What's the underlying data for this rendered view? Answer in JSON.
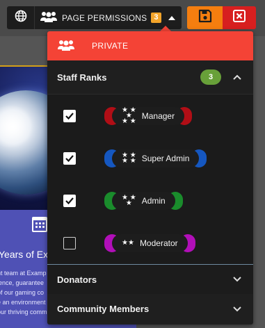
{
  "toolbar": {
    "globe_icon": "globe-icon",
    "permissions_icon": "users-icon",
    "permissions_label": "PAGE PERMISSIONS",
    "permissions_count": "3",
    "caret_icon": "caret-up-icon",
    "save_icon": "floppy-disk-icon",
    "close_icon": "close-square-icon",
    "colors": {
      "bar": "#1d1d1d",
      "badge": "#f3a42a",
      "save": "#f57e0f",
      "close": "#d71f1f"
    }
  },
  "dropdown": {
    "private": {
      "label": "PRIVATE",
      "icon": "users-icon",
      "color": "#f44336"
    },
    "sections": [
      {
        "title": "Staff Ranks",
        "count": "3",
        "count_color": "#68a039",
        "expanded": true,
        "chevron": "chevron-up-icon",
        "ranks": [
          {
            "name": "Manager",
            "checked": true,
            "color": "#b10e16",
            "stars": "5-stars"
          },
          {
            "name": "Super Admin",
            "checked": true,
            "color": "#1557c0",
            "stars": "4-stars"
          },
          {
            "name": "Admin",
            "checked": true,
            "color": "#1a8c2c",
            "stars": "3-stars"
          },
          {
            "name": "Moderator",
            "checked": false,
            "color": "#b10fb8",
            "stars": "2-stars"
          }
        ]
      },
      {
        "title": "Donators",
        "expanded": false,
        "chevron": "chevron-down-icon"
      },
      {
        "title": "Community Members",
        "expanded": false,
        "chevron": "chevron-down-icon"
      }
    ]
  },
  "background": {
    "headline": "Years of Exp",
    "lines": [
      "nt team at Examp",
      "ience, guarantee",
      "of our gaming co",
      "e an environment",
      "our thriving comm"
    ]
  }
}
